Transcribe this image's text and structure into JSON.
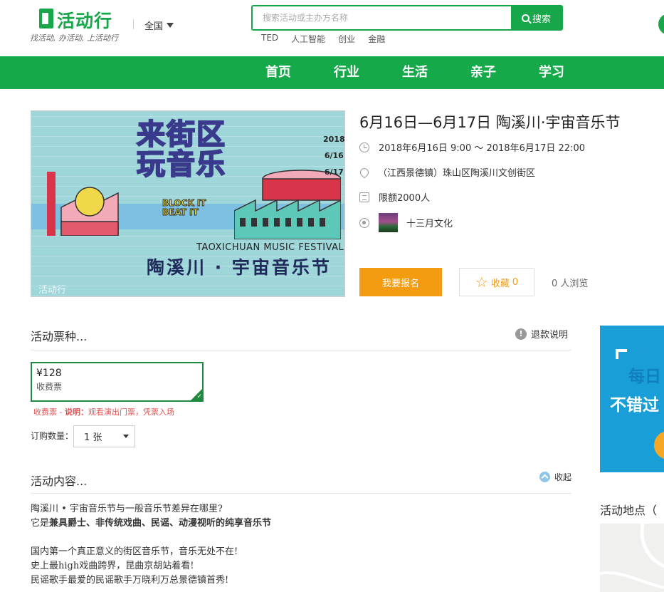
{
  "header": {
    "logo_text": "活动行",
    "slogan": "找活动, 办活动, 上活动行",
    "city": "全国",
    "search_placeholder": "搜索活动或主办方名称",
    "search_button": "搜索",
    "hot_tags": [
      "TED",
      "人工智能",
      "创业",
      "金融"
    ]
  },
  "nav": {
    "items": [
      "首页",
      "行业",
      "生活",
      "亲子",
      "学习"
    ]
  },
  "poster": {
    "title_art": "来街区\n玩音乐",
    "year": "2018",
    "date1": "6/16",
    "date2": "6/17",
    "block_it": "BLOCK IT",
    "beat_it": "BEAT IT",
    "fest_en": "TAOXICHUAN MUSIC FESTIVAL",
    "fest_cn": "陶溪川 · 宇宙音乐节",
    "watermark": "活动行"
  },
  "event": {
    "title": "6月16日—6月17日 陶溪川·宇宙音乐节",
    "time": "2018年6月16日 9:00 ～ 2018年6月17日 22:00",
    "location": "（江西景德镇）珠山区陶溪川文创街区",
    "limit": "限额2000人",
    "organizer": "十三月文化",
    "signup_button": "我要报名",
    "fav_label": "收藏",
    "fav_count": "0",
    "views": "0 人浏览"
  },
  "tickets": {
    "section_title": "活动票种...",
    "refund_label": "退款说明",
    "items": [
      {
        "price": "¥128",
        "kind": "收费票"
      }
    ],
    "note_kind": "收费票",
    "note_sep": " - ",
    "note_label": "说明：",
    "note_text": "观看演出门票，凭票入场",
    "qty_label": "订购数量：",
    "qty_value": "1 张"
  },
  "content": {
    "section_title": "活动内容...",
    "collapse_label": "收起",
    "lines": [
      "陶溪川 • 宇宙音乐节与一般音乐节差异在哪里?",
      "它是兼具爵士、非传统戏曲、民谣、动漫视听的纯享音乐节",
      "",
      "国内第一个真正意义的街区音乐节，音乐无处不在!",
      "史上最high戏曲跨界，昆曲京胡站着看!",
      "民谣歌手最爱的民谣歌手万晓利万总景德镇首秀!"
    ],
    "line2_prefix": "它是",
    "line2_bold": "兼具爵士、非传统戏曲、民谣、动漫视听的纯享音乐节"
  },
  "sidebar": {
    "ad_line1": "每日",
    "ad_line2": "不错过",
    "location_title": "活动地点（"
  }
}
